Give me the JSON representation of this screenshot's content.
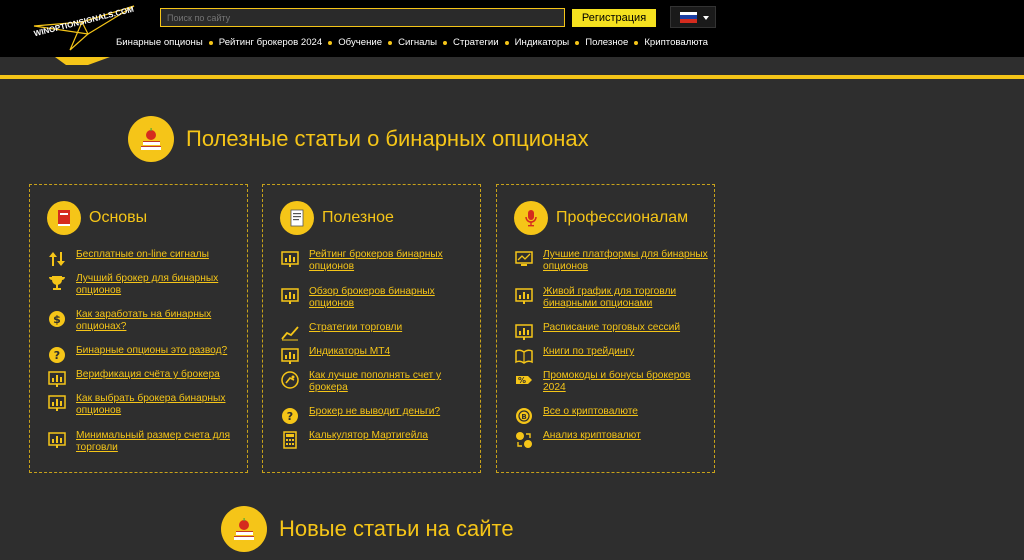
{
  "header": {
    "logo_text": "WINOPTIONSIGNALS.COM",
    "search_placeholder": "Поиск по сайту",
    "register_label": "Регистрация",
    "language": "ru",
    "flag_colors": [
      "#ffffff",
      "#1c3fa3",
      "#d52b1e"
    ]
  },
  "nav": {
    "items": [
      "Бинарные опционы",
      "Рейтинг брокеров 2024",
      "Обучение",
      "Сигналы",
      "Стратегии",
      "Индикаторы",
      "Полезное",
      "Криптовалюта"
    ]
  },
  "sections": {
    "useful": {
      "title": "Полезные статьи о бинарных опционах",
      "icon": "books-apple-icon"
    },
    "new": {
      "title": "Новые статьи на сайте",
      "icon": "books-apple-icon"
    }
  },
  "cards": [
    {
      "title": "Основы",
      "icon": "book-icon",
      "links": [
        {
          "text": "Бесплатные on-line сигналы",
          "icon": "arrows-up-down-icon"
        },
        {
          "text": "Лучший брокер для бинарных опционов",
          "icon": "trophy-icon"
        },
        {
          "text": "Как заработать на бинарных опционах?",
          "icon": "dollar-coin-icon"
        },
        {
          "text": "Бинарные опционы это развод?",
          "icon": "question-icon"
        },
        {
          "text": "Верификация счёта у брокера",
          "icon": "chart-board-icon"
        },
        {
          "text": "Как выбрать брокера бинарных опционов",
          "icon": "chart-board-icon"
        },
        {
          "text": "Минимальный размер счета для торговли",
          "icon": "chart-board-icon"
        }
      ]
    },
    {
      "title": "Полезное",
      "icon": "document-icon",
      "links": [
        {
          "text": "Рейтинг брокеров бинарных опционов",
          "icon": "chart-board-icon"
        },
        {
          "text": "Обзор брокеров бинарных опционов",
          "icon": "chart-board-icon"
        },
        {
          "text": "Стратегии торговли",
          "icon": "line-chart-icon"
        },
        {
          "text": "Индикаторы МТ4",
          "icon": "chart-board-icon"
        },
        {
          "text": "Как лучше пополнять счет у брокера",
          "icon": "wallet-icon"
        },
        {
          "text": "Брокер не выводит деньги?",
          "icon": "question-icon"
        },
        {
          "text": "Калькулятор Мартигейла",
          "icon": "calculator-icon"
        }
      ]
    },
    {
      "title": "Профессионалам",
      "icon": "microphone-icon",
      "links": [
        {
          "text": "Лучшие платформы для бинарных опционов",
          "icon": "platform-icon"
        },
        {
          "text": "Живой график для торговли бинарными опционами",
          "icon": "chart-board-icon"
        },
        {
          "text": "Расписание торговых сессий",
          "icon": "chart-board-icon"
        },
        {
          "text": "Книги по трейдингу",
          "icon": "open-book-icon"
        },
        {
          "text": "Промокоды и бонусы брокеров 2024",
          "icon": "percent-tag-icon"
        },
        {
          "text": "Все о криптовалюте",
          "icon": "crypto-coin-icon"
        },
        {
          "text": "Анализ криптовалют",
          "icon": "coins-exchange-icon"
        }
      ]
    }
  ],
  "colors": {
    "accent": "#f5c518",
    "background": "#2e2e2e",
    "header": "#000000",
    "button": "#f5e11f"
  }
}
